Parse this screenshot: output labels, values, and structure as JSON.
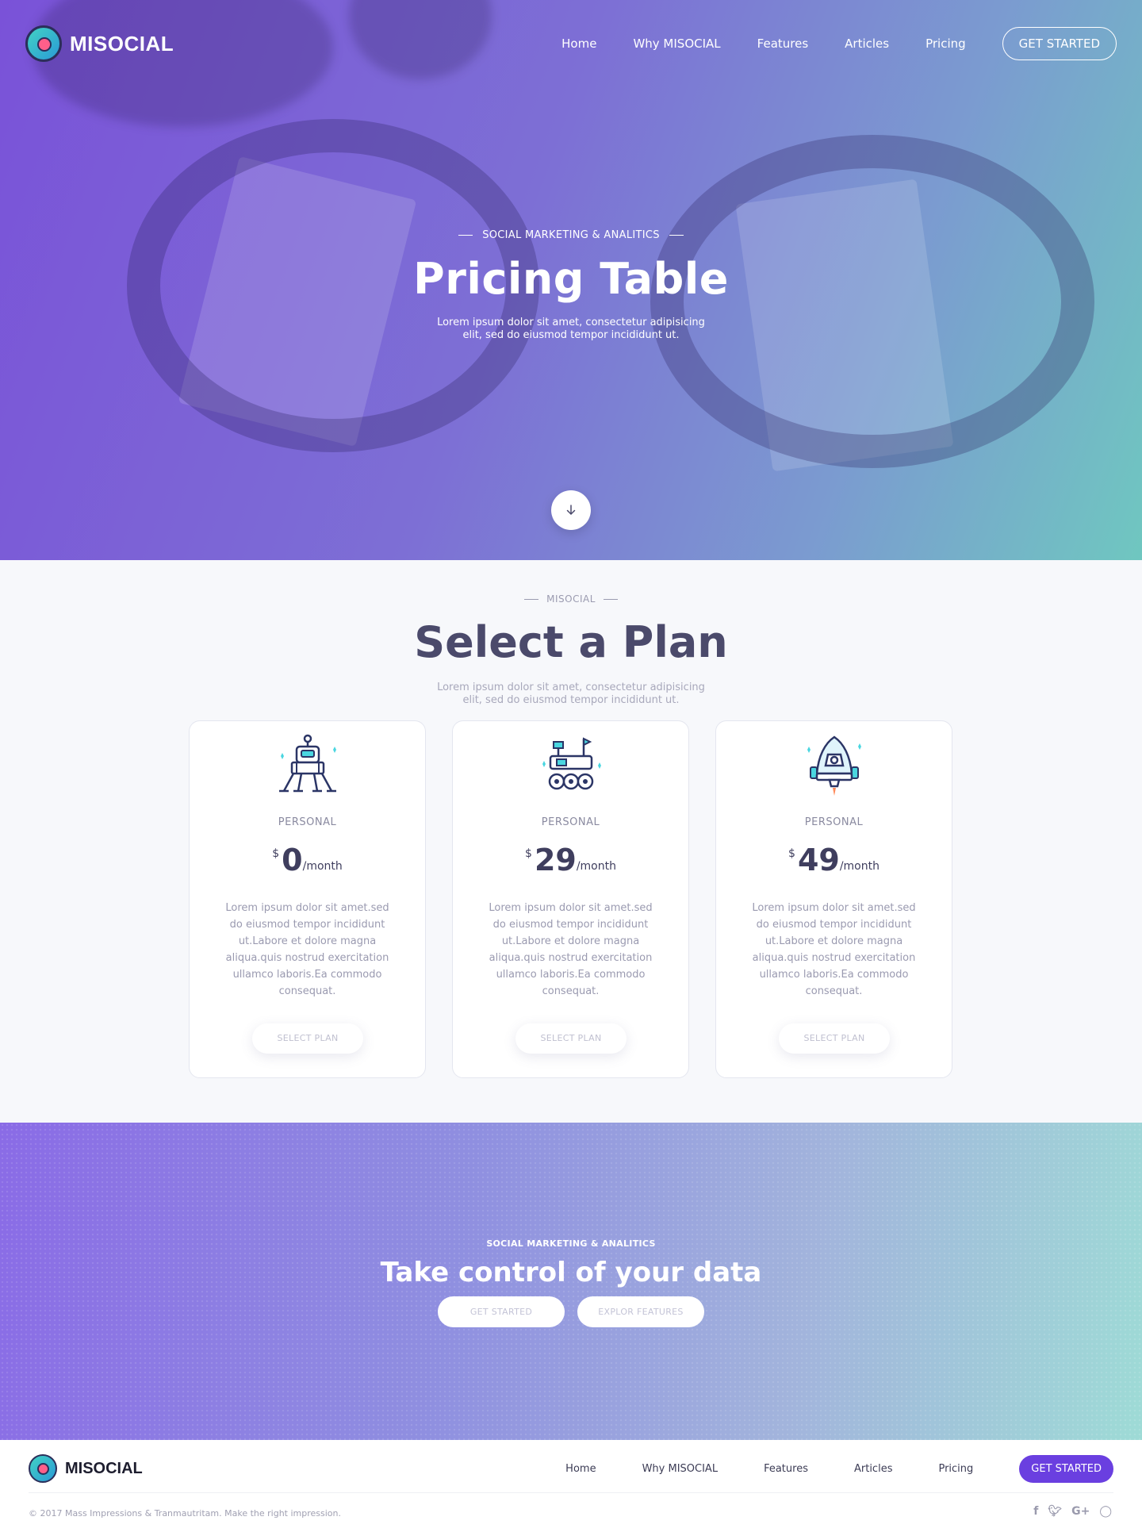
{
  "brand": {
    "name": "MISOCIAL"
  },
  "nav": {
    "links": [
      "Home",
      "Why MISOCIAL",
      "Features",
      "Articles",
      "Pricing"
    ],
    "cta": "GET STARTED"
  },
  "hero": {
    "eyebrow": "SOCIAL MARKETING & ANALITICS",
    "title": "Pricing Table",
    "subtitle": "Lorem ipsum dolor sit amet, consectetur adipisicing elit, sed do eiusmod tempor incididunt ut.",
    "scroll_icon": "arrow-down-icon"
  },
  "pricing": {
    "eyebrow": "MISOCIAL",
    "title": "Select a Plan",
    "subtitle": "Lorem ipsum dolor sit amet, consectetur adipisicing elit, sed do eiusmod tempor incididunt ut.",
    "plans": [
      {
        "icon": "lunar-lander-icon",
        "name": "PERSONAL",
        "currency": "$",
        "amount": "0",
        "period": "/month",
        "description": "Lorem ipsum dolor sit amet.sed do eiusmod tempor incididunt ut.Labore et dolore magna aliqua.quis nostrud exercitation ullamco laboris.Ea commodo consequat.",
        "button": "SELECT PLAN"
      },
      {
        "icon": "moon-rover-icon",
        "name": "PERSONAL",
        "currency": "$",
        "amount": "29",
        "period": "/month",
        "description": "Lorem ipsum dolor sit amet.sed do eiusmod tempor incididunt ut.Labore et dolore magna aliqua.quis nostrud exercitation ullamco laboris.Ea commodo consequat.",
        "button": "SELECT PLAN"
      },
      {
        "icon": "space-capsule-icon",
        "name": "PERSONAL",
        "currency": "$",
        "amount": "49",
        "period": "/month",
        "description": "Lorem ipsum dolor sit amet.sed do eiusmod tempor incididunt ut.Labore et dolore magna aliqua.quis nostrud exercitation ullamco laboris.Ea commodo consequat.",
        "button": "SELECT PLAN"
      }
    ]
  },
  "cta": {
    "eyebrow": "SOCIAL MARKETING & ANALITICS",
    "title": "Take control of your data",
    "primary": "GET STARTED",
    "secondary": "EXPLOR FEATURES"
  },
  "footer": {
    "brand": "MISOCIAL",
    "links": [
      "Home",
      "Why MISOCIAL",
      "Features",
      "Articles",
      "Pricing"
    ],
    "cta": "GET STARTED",
    "copyright": "© 2017 Mass Impressions & Tranmautritam. Make the right impression.",
    "social": [
      "facebook-icon",
      "twitter-icon",
      "google-plus-icon",
      "instagram-icon"
    ]
  },
  "colors": {
    "accent": "#6a3fe0",
    "heading": "#4b4a6b",
    "hero_start": "#7a52d8",
    "hero_end": "#6fc7c0"
  }
}
